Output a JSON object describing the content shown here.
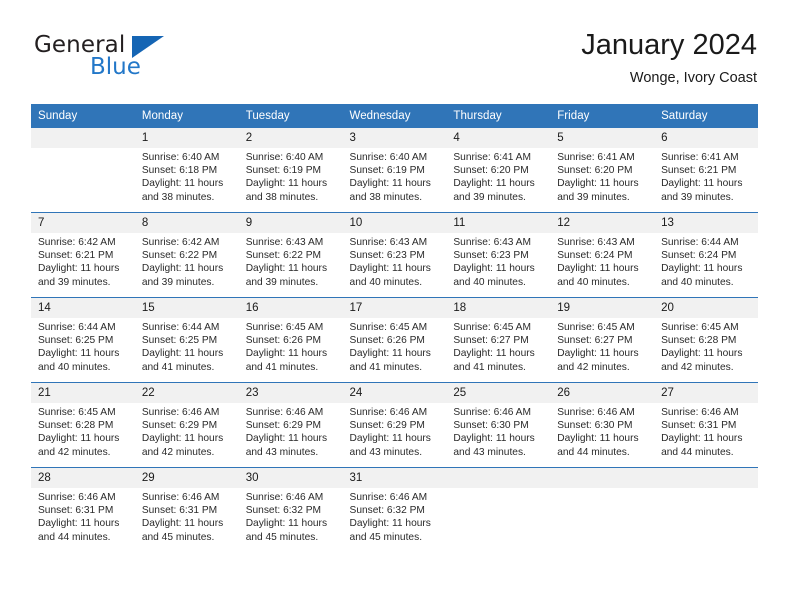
{
  "brand": {
    "name_top": "General",
    "name_bottom": "Blue",
    "accent_color": "#2277c8",
    "triangle_color": "#1565b4"
  },
  "header": {
    "title": "January 2024",
    "subtitle": "Wonge, Ivory Coast"
  },
  "theme": {
    "header_blue": "#3075b8",
    "daynum_bg": "#f1f1f1",
    "text": "#1a1a1a"
  },
  "labels": {
    "sunrise_prefix": "Sunrise:",
    "sunset_prefix": "Sunset:",
    "daylight_prefix": "Daylight:"
  },
  "weekday_headers": [
    "Sunday",
    "Monday",
    "Tuesday",
    "Wednesday",
    "Thursday",
    "Friday",
    "Saturday"
  ],
  "weeks": [
    [
      {
        "day": "",
        "empty": true
      },
      {
        "day": "1",
        "sunrise": "Sunrise: 6:40 AM",
        "sunset": "Sunset: 6:18 PM",
        "daylight_line1": "Daylight: 11 hours",
        "daylight_line2": "and 38 minutes."
      },
      {
        "day": "2",
        "sunrise": "Sunrise: 6:40 AM",
        "sunset": "Sunset: 6:19 PM",
        "daylight_line1": "Daylight: 11 hours",
        "daylight_line2": "and 38 minutes."
      },
      {
        "day": "3",
        "sunrise": "Sunrise: 6:40 AM",
        "sunset": "Sunset: 6:19 PM",
        "daylight_line1": "Daylight: 11 hours",
        "daylight_line2": "and 38 minutes."
      },
      {
        "day": "4",
        "sunrise": "Sunrise: 6:41 AM",
        "sunset": "Sunset: 6:20 PM",
        "daylight_line1": "Daylight: 11 hours",
        "daylight_line2": "and 39 minutes."
      },
      {
        "day": "5",
        "sunrise": "Sunrise: 6:41 AM",
        "sunset": "Sunset: 6:20 PM",
        "daylight_line1": "Daylight: 11 hours",
        "daylight_line2": "and 39 minutes."
      },
      {
        "day": "6",
        "sunrise": "Sunrise: 6:41 AM",
        "sunset": "Sunset: 6:21 PM",
        "daylight_line1": "Daylight: 11 hours",
        "daylight_line2": "and 39 minutes."
      }
    ],
    [
      {
        "day": "7",
        "sunrise": "Sunrise: 6:42 AM",
        "sunset": "Sunset: 6:21 PM",
        "daylight_line1": "Daylight: 11 hours",
        "daylight_line2": "and 39 minutes."
      },
      {
        "day": "8",
        "sunrise": "Sunrise: 6:42 AM",
        "sunset": "Sunset: 6:22 PM",
        "daylight_line1": "Daylight: 11 hours",
        "daylight_line2": "and 39 minutes."
      },
      {
        "day": "9",
        "sunrise": "Sunrise: 6:43 AM",
        "sunset": "Sunset: 6:22 PM",
        "daylight_line1": "Daylight: 11 hours",
        "daylight_line2": "and 39 minutes."
      },
      {
        "day": "10",
        "sunrise": "Sunrise: 6:43 AM",
        "sunset": "Sunset: 6:23 PM",
        "daylight_line1": "Daylight: 11 hours",
        "daylight_line2": "and 40 minutes."
      },
      {
        "day": "11",
        "sunrise": "Sunrise: 6:43 AM",
        "sunset": "Sunset: 6:23 PM",
        "daylight_line1": "Daylight: 11 hours",
        "daylight_line2": "and 40 minutes."
      },
      {
        "day": "12",
        "sunrise": "Sunrise: 6:43 AM",
        "sunset": "Sunset: 6:24 PM",
        "daylight_line1": "Daylight: 11 hours",
        "daylight_line2": "and 40 minutes."
      },
      {
        "day": "13",
        "sunrise": "Sunrise: 6:44 AM",
        "sunset": "Sunset: 6:24 PM",
        "daylight_line1": "Daylight: 11 hours",
        "daylight_line2": "and 40 minutes."
      }
    ],
    [
      {
        "day": "14",
        "sunrise": "Sunrise: 6:44 AM",
        "sunset": "Sunset: 6:25 PM",
        "daylight_line1": "Daylight: 11 hours",
        "daylight_line2": "and 40 minutes."
      },
      {
        "day": "15",
        "sunrise": "Sunrise: 6:44 AM",
        "sunset": "Sunset: 6:25 PM",
        "daylight_line1": "Daylight: 11 hours",
        "daylight_line2": "and 41 minutes."
      },
      {
        "day": "16",
        "sunrise": "Sunrise: 6:45 AM",
        "sunset": "Sunset: 6:26 PM",
        "daylight_line1": "Daylight: 11 hours",
        "daylight_line2": "and 41 minutes."
      },
      {
        "day": "17",
        "sunrise": "Sunrise: 6:45 AM",
        "sunset": "Sunset: 6:26 PM",
        "daylight_line1": "Daylight: 11 hours",
        "daylight_line2": "and 41 minutes."
      },
      {
        "day": "18",
        "sunrise": "Sunrise: 6:45 AM",
        "sunset": "Sunset: 6:27 PM",
        "daylight_line1": "Daylight: 11 hours",
        "daylight_line2": "and 41 minutes."
      },
      {
        "day": "19",
        "sunrise": "Sunrise: 6:45 AM",
        "sunset": "Sunset: 6:27 PM",
        "daylight_line1": "Daylight: 11 hours",
        "daylight_line2": "and 42 minutes."
      },
      {
        "day": "20",
        "sunrise": "Sunrise: 6:45 AM",
        "sunset": "Sunset: 6:28 PM",
        "daylight_line1": "Daylight: 11 hours",
        "daylight_line2": "and 42 minutes."
      }
    ],
    [
      {
        "day": "21",
        "sunrise": "Sunrise: 6:45 AM",
        "sunset": "Sunset: 6:28 PM",
        "daylight_line1": "Daylight: 11 hours",
        "daylight_line2": "and 42 minutes."
      },
      {
        "day": "22",
        "sunrise": "Sunrise: 6:46 AM",
        "sunset": "Sunset: 6:29 PM",
        "daylight_line1": "Daylight: 11 hours",
        "daylight_line2": "and 42 minutes."
      },
      {
        "day": "23",
        "sunrise": "Sunrise: 6:46 AM",
        "sunset": "Sunset: 6:29 PM",
        "daylight_line1": "Daylight: 11 hours",
        "daylight_line2": "and 43 minutes."
      },
      {
        "day": "24",
        "sunrise": "Sunrise: 6:46 AM",
        "sunset": "Sunset: 6:29 PM",
        "daylight_line1": "Daylight: 11 hours",
        "daylight_line2": "and 43 minutes."
      },
      {
        "day": "25",
        "sunrise": "Sunrise: 6:46 AM",
        "sunset": "Sunset: 6:30 PM",
        "daylight_line1": "Daylight: 11 hours",
        "daylight_line2": "and 43 minutes."
      },
      {
        "day": "26",
        "sunrise": "Sunrise: 6:46 AM",
        "sunset": "Sunset: 6:30 PM",
        "daylight_line1": "Daylight: 11 hours",
        "daylight_line2": "and 44 minutes."
      },
      {
        "day": "27",
        "sunrise": "Sunrise: 6:46 AM",
        "sunset": "Sunset: 6:31 PM",
        "daylight_line1": "Daylight: 11 hours",
        "daylight_line2": "and 44 minutes."
      }
    ],
    [
      {
        "day": "28",
        "sunrise": "Sunrise: 6:46 AM",
        "sunset": "Sunset: 6:31 PM",
        "daylight_line1": "Daylight: 11 hours",
        "daylight_line2": "and 44 minutes."
      },
      {
        "day": "29",
        "sunrise": "Sunrise: 6:46 AM",
        "sunset": "Sunset: 6:31 PM",
        "daylight_line1": "Daylight: 11 hours",
        "daylight_line2": "and 45 minutes."
      },
      {
        "day": "30",
        "sunrise": "Sunrise: 6:46 AM",
        "sunset": "Sunset: 6:32 PM",
        "daylight_line1": "Daylight: 11 hours",
        "daylight_line2": "and 45 minutes."
      },
      {
        "day": "31",
        "sunrise": "Sunrise: 6:46 AM",
        "sunset": "Sunset: 6:32 PM",
        "daylight_line1": "Daylight: 11 hours",
        "daylight_line2": "and 45 minutes."
      },
      {
        "day": "",
        "empty": true
      },
      {
        "day": "",
        "empty": true
      },
      {
        "day": "",
        "empty": true
      }
    ]
  ]
}
